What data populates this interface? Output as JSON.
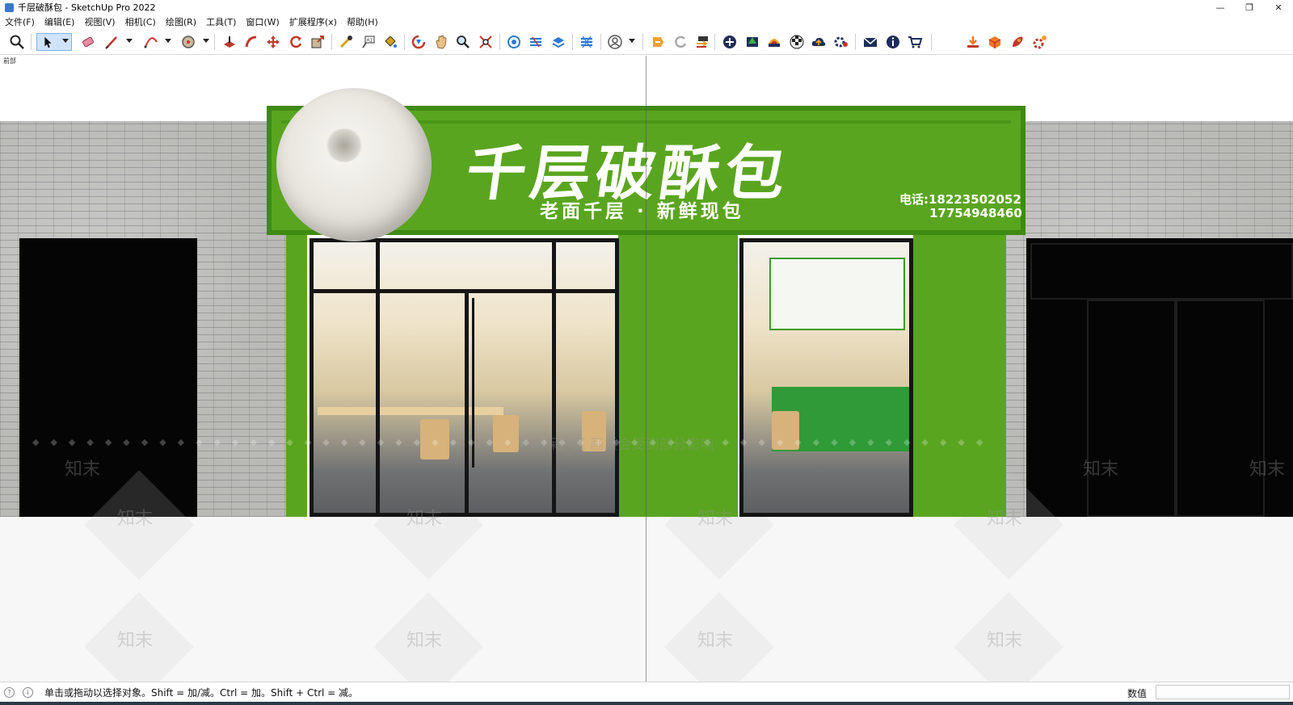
{
  "window": {
    "title": "千层破酥包 - SketchUp Pro 2022",
    "minimize": "—",
    "restore": "❐",
    "close": "✕"
  },
  "menu": [
    "文件(F)",
    "编辑(E)",
    "视图(V)",
    "相机(C)",
    "绘图(R)",
    "工具(T)",
    "窗口(W)",
    "扩展程序(x)",
    "帮助(H)"
  ],
  "scene_label": "前部",
  "sign": {
    "title": "千层破酥包",
    "slogan": "老面千层 · 新鲜现包",
    "phone_line1": "电话:18223502052",
    "phone_line2": "17754948460"
  },
  "watermark": {
    "brand": "知末",
    "notice": "水印保护区 画质会受到部分影响"
  },
  "status": {
    "hint": "单击或拖动以选择对象。Shift = 加/减。Ctrl = 加。Shift + Ctrl = 减。",
    "measure_label": "数值",
    "measure_value": ""
  },
  "colors": {
    "sign_green": "#5aa51f",
    "toolbar_active": "#cfe4fb"
  }
}
